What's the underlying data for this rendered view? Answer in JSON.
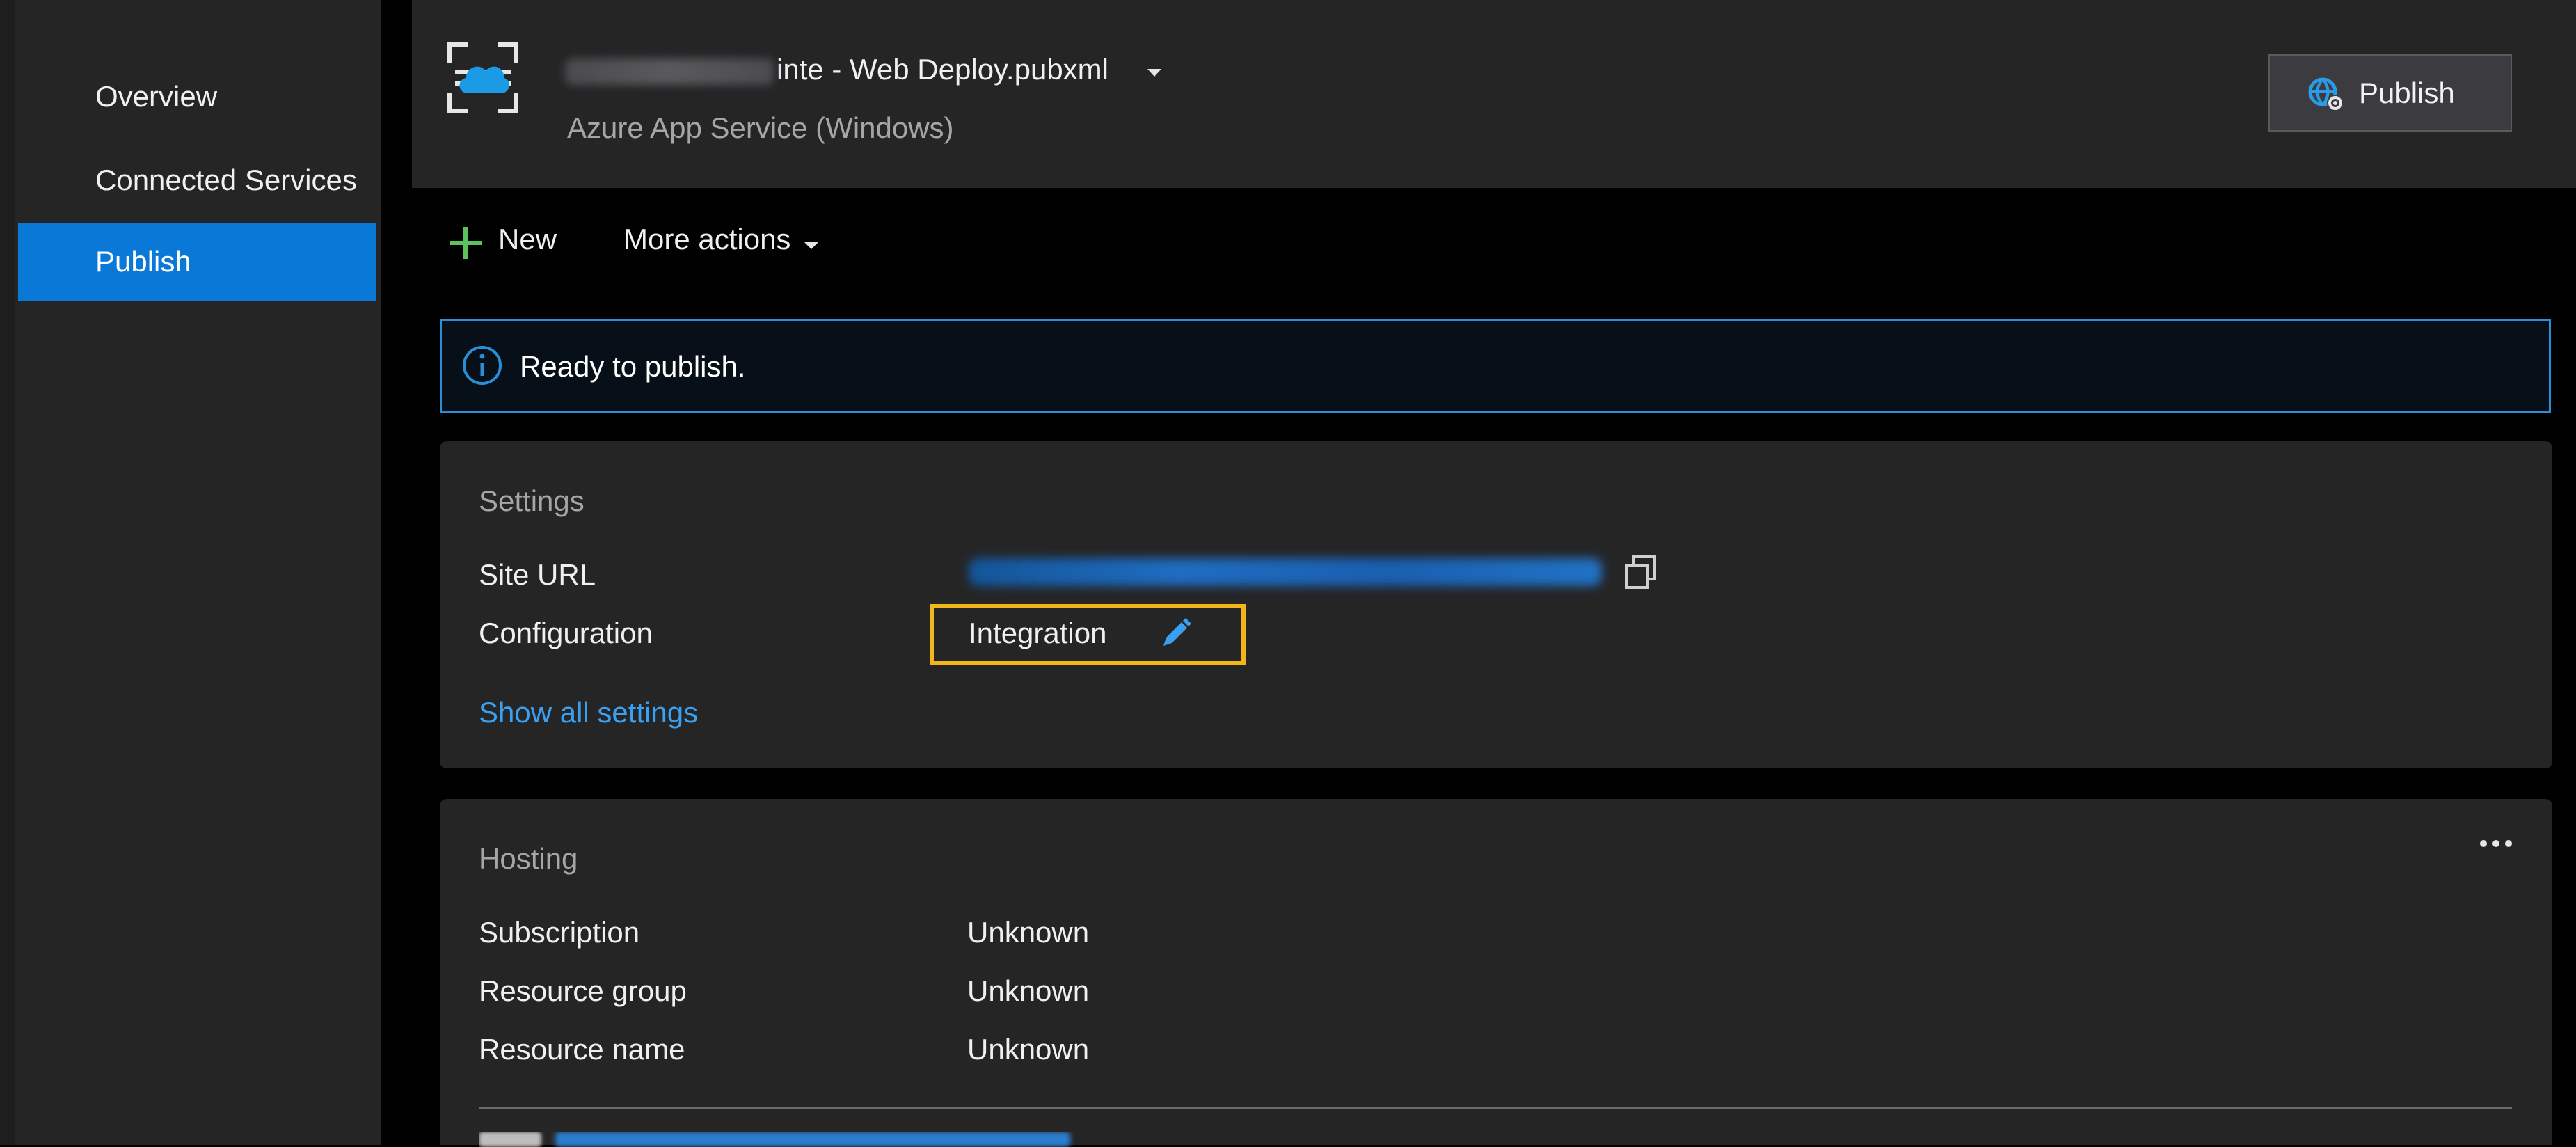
{
  "nav": {
    "items": [
      {
        "label": "Overview",
        "active": false
      },
      {
        "label": "Connected Services",
        "active": false
      },
      {
        "label": "Publish",
        "active": true
      }
    ]
  },
  "profile": {
    "name_suffix": "inte - Web Deploy.pubxml",
    "target_type": "Azure App Service (Windows)"
  },
  "header": {
    "publish_label": "Publish"
  },
  "toolbar": {
    "new_label": "New",
    "more_actions_label": "More actions"
  },
  "info": {
    "message": "Ready to publish."
  },
  "settings": {
    "title": "Settings",
    "site_url_label": "Site URL",
    "configuration_label": "Configuration",
    "configuration_value": "Integration",
    "show_all_label": "Show all settings"
  },
  "hosting": {
    "title": "Hosting",
    "rows": [
      {
        "label": "Subscription",
        "value": "Unknown"
      },
      {
        "label": "Resource group",
        "value": "Unknown"
      },
      {
        "label": "Resource name",
        "value": "Unknown"
      }
    ]
  },
  "colors": {
    "accent": "#0a78d7",
    "link": "#3aa0f2",
    "highlight": "#f2b61a",
    "info_border": "#2b8fd8"
  },
  "icons": [
    "cloud-scan-icon",
    "chevron-down-icon",
    "globe-publish-icon",
    "plus-icon",
    "info-icon",
    "copy-icon",
    "pencil-icon",
    "more-icon"
  ]
}
